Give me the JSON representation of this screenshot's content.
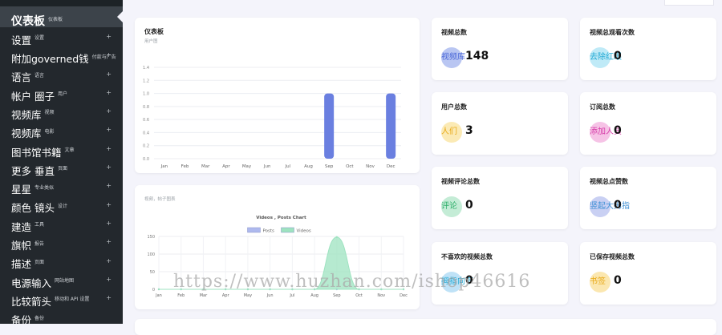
{
  "sidebar": {
    "items": [
      {
        "label": "仪表板",
        "sub": "仪表板",
        "active": true,
        "has_plus": false
      },
      {
        "label": "设置",
        "sub": "设置",
        "has_plus": true
      },
      {
        "label": "附加governed钱",
        "sub": "付款与广告",
        "has_plus": true
      },
      {
        "label": "语言",
        "sub": "语言",
        "has_plus": true
      },
      {
        "label": "帐户  圈子",
        "sub": "用户",
        "has_plus": true
      },
      {
        "label": "视频库",
        "sub": "视频",
        "has_plus": true
      },
      {
        "label": "视频库",
        "sub": "电影",
        "has_plus": true
      },
      {
        "label": "图书馆书籍",
        "sub": "文章",
        "has_plus": true
      },
      {
        "label": "更多  垂直",
        "sub": "页面",
        "has_plus": true
      },
      {
        "label": "星星",
        "sub": "专业类似",
        "has_plus": true
      },
      {
        "label": "颜色  镜头",
        "sub": "设计",
        "has_plus": true
      },
      {
        "label": "建造",
        "sub": "工具",
        "has_plus": true
      },
      {
        "label": "旗帜",
        "sub": "报告",
        "has_plus": true
      },
      {
        "label": "描述",
        "sub": "页面",
        "has_plus": true
      },
      {
        "label": "电源输入",
        "sub": "网站地图",
        "has_plus": true
      },
      {
        "label": "比较箭头",
        "sub": "移动和 API 设置",
        "has_plus": true
      },
      {
        "label": "备份",
        "sub": "备份",
        "has_plus": false
      }
    ]
  },
  "dashboard_card": {
    "title": "仪表板",
    "subtitle": "用户图"
  },
  "videos_card": {
    "subtitle": "视频，帖子图表"
  },
  "stats": [
    {
      "title": "视频总数",
      "icon_text": "视频库",
      "value": "148",
      "color": "#b9c6f2",
      "text_color": "#4a67d8"
    },
    {
      "title": "视频总观看次数",
      "icon_text": "去除红眼",
      "value": "0",
      "color": "#bfeaf7",
      "text_color": "#21a9d4"
    },
    {
      "title": "用户总数",
      "icon_text": "人们",
      "value": "3",
      "color": "#fbeab5",
      "text_color": "#e8a917"
    },
    {
      "title": "订阅总数",
      "icon_text": "添加人员",
      "value": "0",
      "color": "#f6c3e6",
      "text_color": "#d63ba8"
    },
    {
      "title": "视频评论总数",
      "icon_text": "评论",
      "value": "0",
      "color": "#c4ecd6",
      "text_color": "#2fae6a"
    },
    {
      "title": "视频总点赞数",
      "icon_text": "竖起大拇指",
      "value": "0",
      "color": "#c9d0f3",
      "text_color": "#3d8fd4"
    },
    {
      "title": "不喜欢的视频总数",
      "icon_text": "拇指向下",
      "value": "0",
      "color": "#bfe2f7",
      "text_color": "#21a9d4"
    },
    {
      "title": "已保存视频总数",
      "icon_text": "书签",
      "value": "0",
      "color": "#fbe7b0",
      "text_color": "#e8a917"
    }
  ],
  "watermark": "https://www.huzhan.com/ishop46616",
  "chart_data": [
    {
      "type": "bar",
      "categories": [
        "Jan",
        "Feb",
        "Mar",
        "Apr",
        "May",
        "Jun",
        "Jul",
        "Aug",
        "Sep",
        "Oct",
        "Nov",
        "Dec"
      ],
      "values": [
        0,
        0,
        0,
        0,
        0,
        0,
        0,
        0,
        1,
        0,
        0,
        1
      ],
      "ylim": [
        0,
        1.4
      ],
      "yticks": [
        "0.0",
        "0.2",
        "0.4",
        "0.6",
        "0.8",
        "1.0",
        "1.2",
        "1.4"
      ],
      "colors": {
        "bar": "#6a7fe0"
      },
      "grid": true
    },
    {
      "type": "area",
      "title": "Videos , Posts Chart",
      "categories": [
        "Jan",
        "Feb",
        "Mar",
        "Apr",
        "May",
        "Jun",
        "Jul",
        "Aug",
        "Sep",
        "Oct",
        "Nov",
        "Dec"
      ],
      "series": [
        {
          "name": "Posts",
          "values": [
            0,
            0,
            0,
            0,
            0,
            0,
            0,
            0,
            0,
            0,
            0,
            0
          ],
          "color": "#aeb9ee"
        },
        {
          "name": "Videos",
          "values": [
            0,
            0,
            0,
            0,
            0,
            0,
            0,
            0,
            148,
            0,
            0,
            0
          ],
          "color": "#9ee3c0"
        }
      ],
      "ylim": [
        0,
        150
      ],
      "yticks": [
        "0",
        "50",
        "100",
        "150"
      ],
      "legend": "top",
      "grid": true
    }
  ]
}
